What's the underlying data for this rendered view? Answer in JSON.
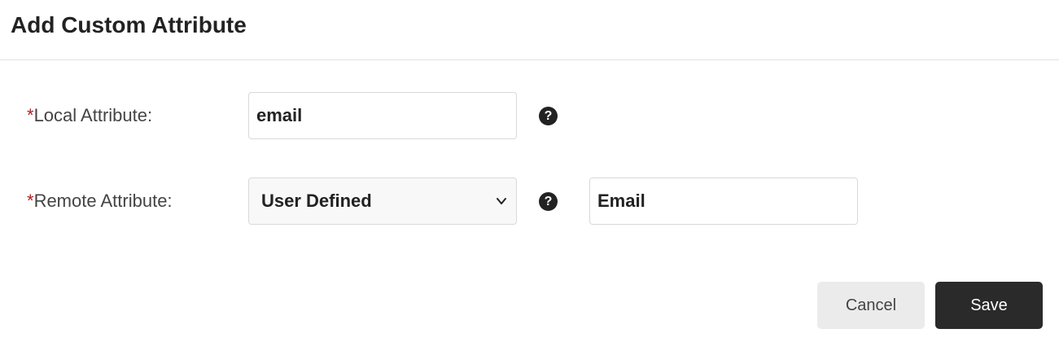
{
  "dialog": {
    "title": "Add Custom Attribute"
  },
  "form": {
    "required_marker": "*",
    "local_attribute": {
      "label": "Local Attribute:",
      "value": "email",
      "help_icon": "question-circle-icon",
      "help_glyph": "?"
    },
    "remote_attribute": {
      "label": "Remote Attribute:",
      "selected": "User Defined",
      "help_icon": "question-circle-icon",
      "help_glyph": "?",
      "custom_value": "Email"
    }
  },
  "buttons": {
    "cancel": "Cancel",
    "save": "Save"
  },
  "colors": {
    "required": "#b01e1e",
    "primary_button": "#2a2a2a",
    "secondary_button": "#ebebeb"
  }
}
